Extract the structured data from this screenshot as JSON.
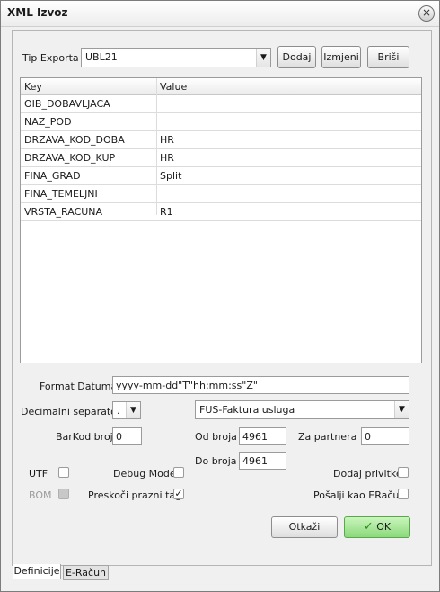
{
  "window": {
    "title": "XML Izvoz"
  },
  "export": {
    "type_label": "Tip Exporta",
    "type_value": "UBL21",
    "add_label": "Dodaj",
    "edit_label": "Izmjeni",
    "delete_label": "Briši"
  },
  "table": {
    "columns": [
      "Key",
      "Value"
    ],
    "rows": [
      [
        "OIB_DOBAVLJACA",
        ""
      ],
      [
        "NAZ_POD",
        ""
      ],
      [
        "DRZAVA_KOD_DOBA",
        "HR"
      ],
      [
        "DRZAVA_KOD_KUP",
        "HR"
      ],
      [
        "FINA_GRAD",
        "Split"
      ],
      [
        "FINA_TEMELJNI",
        ""
      ],
      [
        "VRSTA_RACUNA",
        "R1"
      ]
    ]
  },
  "form": {
    "date_format_label": "Format Datuma",
    "date_format_value": "yyyy-mm-dd\"T\"hh:mm:ss\"Z\"",
    "decimal_sep_label": "Decimalni separator",
    "decimal_sep_value": ".",
    "doc_type_value": "FUS-Faktura usluga",
    "barcode_label": "BarKod broj",
    "barcode_value": "0",
    "from_label": "Od broja",
    "from_value": "4961",
    "to_label": "Do broja",
    "to_value": "4961",
    "partner_label": "Za partnera :",
    "partner_value": "0",
    "utf_label": "UTF",
    "bom_label": "BOM",
    "debug_label": "Debug Mode",
    "skip_empty_label": "Preskoči prazni tag",
    "attach_label": "Dodaj privitke",
    "send_label": "Pošalji kao ERačun"
  },
  "actions": {
    "cancel_label": "Otkaži",
    "ok_label": "OK"
  },
  "tabs": [
    "Definicije",
    "E-Račun"
  ],
  "colors": {
    "ok_button": "#8bd97a",
    "accent": "#2e8b1e"
  }
}
